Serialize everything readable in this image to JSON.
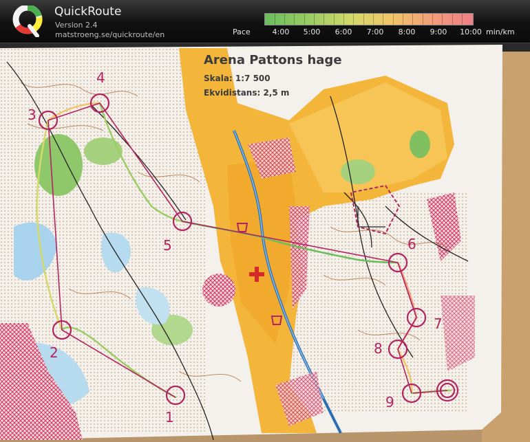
{
  "app": {
    "title": "QuickRoute",
    "version": "Version 2.4",
    "url": "matstroeng.se/quickroute/en"
  },
  "pace_legend": {
    "label": "Pace",
    "ticks": [
      "4:00",
      "5:00",
      "6:00",
      "7:00",
      "8:00",
      "9:00",
      "10:00"
    ],
    "unit": "min/km",
    "colors": [
      "#6bbd5e",
      "#9ccc64",
      "#d5d96a",
      "#f2c46a",
      "#f29a7a",
      "#ee7f86"
    ]
  },
  "map": {
    "title": "Arena Pattons hage",
    "scale": "Skala: 1:7 500",
    "contour": "Ekvidistans: 2,5 m",
    "controls": [
      "1",
      "2",
      "3",
      "4",
      "5",
      "6",
      "7",
      "8",
      "9"
    ]
  }
}
